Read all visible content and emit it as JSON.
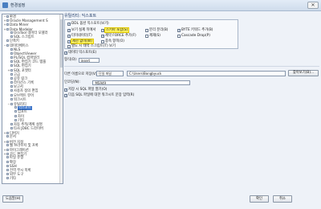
{
  "window": {
    "title": "환경설정",
    "close_label": "✕"
  },
  "tree": {
    "items": [
      {
        "label": "환경",
        "toggle": "−",
        "depth": 0
      },
      {
        "label": "Oracle Management S",
        "toggle": "+",
        "depth": 0
      },
      {
        "label": "Data Miner",
        "toggle": "+",
        "depth": 0
      },
      {
        "label": "Data Modeler",
        "toggle": "+",
        "depth": 0
      },
      {
        "label": "OraTool 데이터 모델러",
        "toggle": "",
        "depth": 1
      },
      {
        "label": "SQL 스크립트",
        "toggle": "",
        "depth": 1
      },
      {
        "label": "단축키",
        "toggle": "",
        "depth": 0
      },
      {
        "label": "데이터베이스",
        "toggle": "−",
        "depth": 0
      },
      {
        "label": "NLS",
        "toggle": "",
        "depth": 1
      },
      {
        "label": "ObjectViewer",
        "toggle": "",
        "depth": 1
      },
      {
        "label": "PL/SQL 컴파일러",
        "toggle": "",
        "depth": 1
      },
      {
        "label": "SQL 편집기 코드 템플",
        "toggle": "",
        "depth": 1
      },
      {
        "label": "SQL 편집기",
        "toggle": "",
        "depth": 1
      },
      {
        "label": "SQL 포맷터",
        "toggle": "+",
        "depth": 1
      },
      {
        "label": "고급",
        "toggle": "",
        "depth": 1
      },
      {
        "label": "공유 링크",
        "toggle": "",
        "depth": 1
      },
      {
        "label": "라이선스 기록",
        "toggle": "",
        "depth": 1
      },
      {
        "label": "보고서",
        "toggle": "",
        "depth": 1
      },
      {
        "label": "사용자 정의 편집",
        "toggle": "",
        "depth": 1
      },
      {
        "label": "오브젝트 뷰어",
        "toggle": "",
        "depth": 1
      },
      {
        "label": "워크시트",
        "toggle": "",
        "depth": 1
      },
      {
        "label": "유틸리티",
        "toggle": "−",
        "depth": 1
      },
      {
        "label": "익스포트",
        "toggle": "",
        "depth": 2,
        "selected": true
      },
      {
        "label": "임포트",
        "toggle": "",
        "depth": 2
      },
      {
        "label": "차이",
        "toggle": "",
        "depth": 2
      },
      {
        "label": "기타",
        "toggle": "",
        "depth": 2
      },
      {
        "label": "자동 추적/계획 설명",
        "toggle": "",
        "depth": 1
      },
      {
        "label": "타사 JDBC 드라이버",
        "toggle": "",
        "depth": 1
      },
      {
        "label": "디버거",
        "toggle": "+",
        "depth": 0
      },
      {
        "label": "문서",
        "toggle": "",
        "depth": 0
      },
      {
        "label": "버전 지정",
        "toggle": "+",
        "depth": 0
      },
      {
        "label": "웹 브라우저 및 프록",
        "toggle": "",
        "depth": 0
      },
      {
        "label": "마이그레이션",
        "toggle": "+",
        "depth": 0
      },
      {
        "label": "코드 편집기",
        "toggle": "+",
        "depth": 0
      },
      {
        "label": "파일 유형",
        "toggle": "",
        "depth": 0
      },
      {
        "label": "확장",
        "toggle": "",
        "depth": 0
      },
      {
        "label": "SSH",
        "toggle": "",
        "depth": 0
      },
      {
        "label": "전역 무시 목록",
        "toggle": "",
        "depth": 0
      },
      {
        "label": "외부 도구",
        "toggle": "",
        "depth": 0
      },
      {
        "label": "기타",
        "toggle": "",
        "depth": 0
      }
    ]
  },
  "main": {
    "section_title": "유틸리티: 익스포트",
    "checkboxes_row1": [
      {
        "label": "DDL 옵션 익스포트(보기)",
        "checked": true
      }
    ],
    "checkboxes": [
      {
        "label": "보기 실제 뒤에서",
        "checked": true
      },
      {
        "label": "스키마 포함(S)",
        "checked": true,
        "highlight": true
      },
      {
        "label": "분리 분리(B)",
        "checked": false
      },
      {
        "label": "BYTE 키워드 추가(B)",
        "checked": true
      },
      {
        "label": "터미네이터(T)",
        "checked": true
      },
      {
        "label": "제약 FORCE 추가(F)",
        "checked": true
      },
      {
        "label": "제재(S)",
        "checked": false
      },
      {
        "label": "Cascade Drop(P)",
        "checked": false
      },
      {
        "label": "제한 없이(W)",
        "checked": true,
        "highlight": true
      },
      {
        "label": "종속 항목(O)",
        "checked": false
      },
      {
        "label": "별도 시 태억 스크립트(T) 보기",
        "checked": false
      }
    ],
    "export_data_label": "데이터 익스포트(E)",
    "export_data_checked": true,
    "format_label": "형식(O):",
    "format_value": "insert",
    "save_as_label": "다른 이름으로 저장(V)",
    "save_as_value": "단일 파일",
    "path_value": "C:\\Users\\Bongbyuck",
    "browse_label": "찾아보기(B)...",
    "encoding_label": "인코딩(N):",
    "encoding_value": "MS949",
    "option_labels": [
      {
        "label": "저장 시 SQL 파일 열기(O)",
        "checked": true
      },
      {
        "label": "다음 SQL 파일에 대한 워크시트 문장 입력(R)",
        "checked": true
      }
    ]
  },
  "footer": {
    "help_label": "도움말(H)",
    "ok_label": "확인",
    "cancel_label": "취소"
  }
}
